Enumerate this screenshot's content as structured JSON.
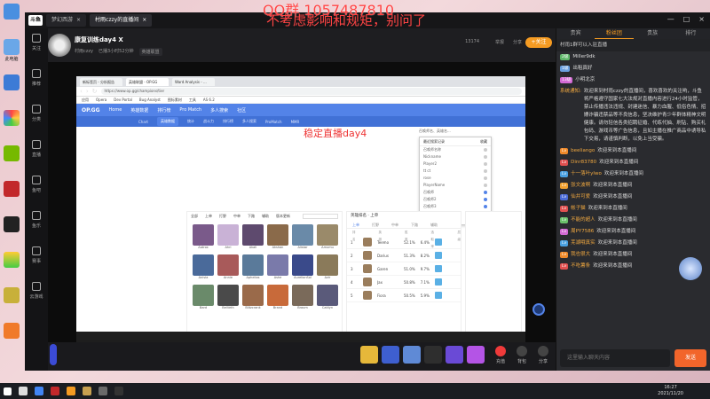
{
  "desktop": {
    "icons": [
      "",
      "",
      "",
      "",
      "",
      "",
      "",
      "",
      "",
      "",
      ""
    ],
    "labels": [
      "",
      "此电脑",
      "",
      "",
      "",
      "",
      "",
      "",
      "",
      "",
      ""
    ]
  },
  "overlay_text": {
    "line1": "QQ群 1057487810",
    "line2": "不考虑影响和规矩，别问了"
  },
  "app": {
    "logo": "斗鱼",
    "tabs": [
      {
        "label": "梦幻西游",
        "active": false
      },
      {
        "label": "村雨czzy的直播间",
        "active": true
      }
    ],
    "win_controls": [
      "—",
      "□",
      "×"
    ],
    "left_nav": [
      "关注",
      "推荐",
      "分类",
      "直播",
      "鱼吧",
      "鱼乐",
      "赛事",
      "云游戏"
    ]
  },
  "room": {
    "title": "康复训练day4 X",
    "meta": [
      "村雨czzy",
      "已播3小时52分钟"
    ],
    "tag": "英雄联盟",
    "viewers": "13174",
    "follow_label": "+关注",
    "report": "举报",
    "share": "分享"
  },
  "stream": {
    "watermark": "稳定直播day4",
    "browser": {
      "tabs": [
        "新标签页 - 分析报告",
        "英雄联盟 - OP.GG",
        "Ward Analysis - ..."
      ],
      "url": "https://www.op.gg/champions/tier",
      "bookmarks": [
        "应用",
        "Opera",
        "Dev Portal",
        "Bug Analyst",
        "图标素材",
        "工具",
        "AS 6.2"
      ]
    },
    "opgg": {
      "logo": "OP.GG",
      "nav": [
        "Home",
        "英雄数据",
        "排行榜",
        "Pro Match",
        "多人搜索",
        "社区"
      ],
      "subnav": [
        "Chart",
        "英雄数据",
        "统计",
        "战斗力",
        "排行榜",
        "多人搜索",
        "ProMatch",
        "MMR"
      ],
      "search_placeholder": "召唤师名、英雄名...",
      "dropdown_header": [
        "最近搜索记录",
        "收藏"
      ],
      "dropdown_items": [
        "召唤师名称",
        "Nickname",
        "Player2",
        "tt ct",
        "rose",
        "PlayerName",
        "召唤师",
        "召唤师2",
        "召唤师3",
        "player123"
      ],
      "champ_tabs": [
        "全部",
        "上单",
        "打野",
        "中单",
        "下路",
        "辅助",
        "版本更新"
      ],
      "champions": [
        "Aatrox",
        "Ahri",
        "Akali",
        "Akshan",
        "Alistar",
        "Amumu",
        "Anivia",
        "Annie",
        "Aphelios",
        "Ashe",
        "AurelionSol",
        "Azir",
        "Bard",
        "BelVeth",
        "Blitzcrank",
        "Brand",
        "Braum",
        "Caitlyn"
      ],
      "tier_title": "英雄排名 · 上单",
      "tier_tabs": [
        "上单",
        "打野",
        "中单",
        "下路",
        "辅助"
      ],
      "tier_cols": [
        "排名",
        "英雄",
        "胜率",
        "选取率",
        "层级"
      ],
      "tier_rows": [
        {
          "rank": "1",
          "name": "Teemo",
          "win": "52.1%",
          "pick": "6.4%"
        },
        {
          "rank": "2",
          "name": "Darius",
          "win": "51.3%",
          "pick": "8.2%"
        },
        {
          "rank": "3",
          "name": "Garen",
          "win": "51.0%",
          "pick": "9.7%"
        },
        {
          "rank": "4",
          "name": "Jax",
          "win": "50.8%",
          "pick": "7.1%"
        },
        {
          "rank": "5",
          "name": "Fiora",
          "win": "50.5%",
          "pick": "5.9%"
        }
      ]
    }
  },
  "controls": {
    "gifts": [
      "",
      "",
      "",
      "",
      "",
      "",
      ""
    ],
    "buttons": [
      "充值",
      "背包",
      "分享"
    ],
    "level_badge": "100",
    "fans_count": "1779"
  },
  "chat": {
    "tabs": [
      "贵宾",
      "粉丝团",
      "贵族",
      "排行"
    ],
    "active_tab": "粉丝团",
    "notice": "村雨1群可以入驻直播",
    "messages": [
      {
        "badge": "2级",
        "user": "",
        "text": "Miller9dk"
      },
      {
        "badge": "1级",
        "user": "",
        "text": "出租真好"
      },
      {
        "badge": "13级",
        "user": "",
        "text": "小明北京"
      },
      {
        "badge": "",
        "user": "系统通知:",
        "text": "欢迎来到村雨czzy的直播间，喜欢喜欢的关注哟，斗鱼将严格遵守国家七大法规对直播内容进行24小时监管，禁止传播违法违规、封建迷信、暴力血腥、低俗色情、招嫖诈骗违禁品等不良信息，坚决维护青少年群体精神文明健康。请勿轻信各类招聘征婚、代练代抽、刷钻、购买礼包码、游戏币等广告信息，且如主播在推广商品中诱导私下交易，请谨慎判断，以免上当受骗。"
      },
      {
        "badge": "Lv",
        "user": "beeliango",
        "text": "欢迎来到本直播间"
      },
      {
        "badge": "Lv",
        "user": "Dinr83780",
        "text": "欢迎来到本直播间"
      },
      {
        "badge": "Lv",
        "user": "十一落叶ylwo",
        "text": "欢迎来到本直播间"
      },
      {
        "badge": "Lv",
        "user": "张文波啊",
        "text": "欢迎来到本直播间"
      },
      {
        "badge": "Lv",
        "user": "仙井可爱",
        "text": "欢迎来到本直播间"
      },
      {
        "badge": "Lv",
        "user": "帐子猫",
        "text": "欢迎来到本直播间"
      },
      {
        "badge": "Lv",
        "user": "不能的超人",
        "text": "欢迎来到本直播间"
      },
      {
        "badge": "Lv",
        "user": "周PY7586",
        "text": "欢迎来到本直播间"
      },
      {
        "badge": "Lv",
        "user": "芜湖哦真实",
        "text": "欢迎来到本直播间"
      },
      {
        "badge": "Lv",
        "user": "我也很大",
        "text": "欢迎来到本直播间"
      },
      {
        "badge": "Lv",
        "user": "不吃薯条",
        "text": "欢迎来到本直播间"
      }
    ],
    "input_placeholder": "这里输入聊天内容",
    "send_label": "发送"
  },
  "taskbar": {
    "time": "16:27",
    "date": "2021/11/20"
  },
  "colors": {
    "accent": "#f59b22",
    "opgg": "#5383e8",
    "send": "#f2652b",
    "overlay": "#ff4444"
  }
}
